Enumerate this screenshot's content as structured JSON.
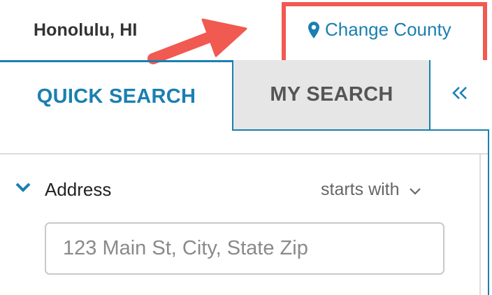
{
  "header": {
    "location": "Honolulu, HI",
    "change_county_label": "Change County",
    "change_county_icon": "map-marker-icon",
    "highlight_color": "#f05a50"
  },
  "tabs": [
    {
      "label": "QUICK SEARCH",
      "active": true
    },
    {
      "label": "MY SEARCH",
      "active": false
    }
  ],
  "collapse_icon": "double-chevron-left-icon",
  "address": {
    "label": "Address",
    "expanded": true,
    "match_mode": "starts with",
    "placeholder": "123 Main St, City, State Zip",
    "value": ""
  },
  "colors": {
    "accent": "#1a7fb1",
    "tab_inactive_bg": "#e6e6e6",
    "annotation": "#f05a50"
  }
}
